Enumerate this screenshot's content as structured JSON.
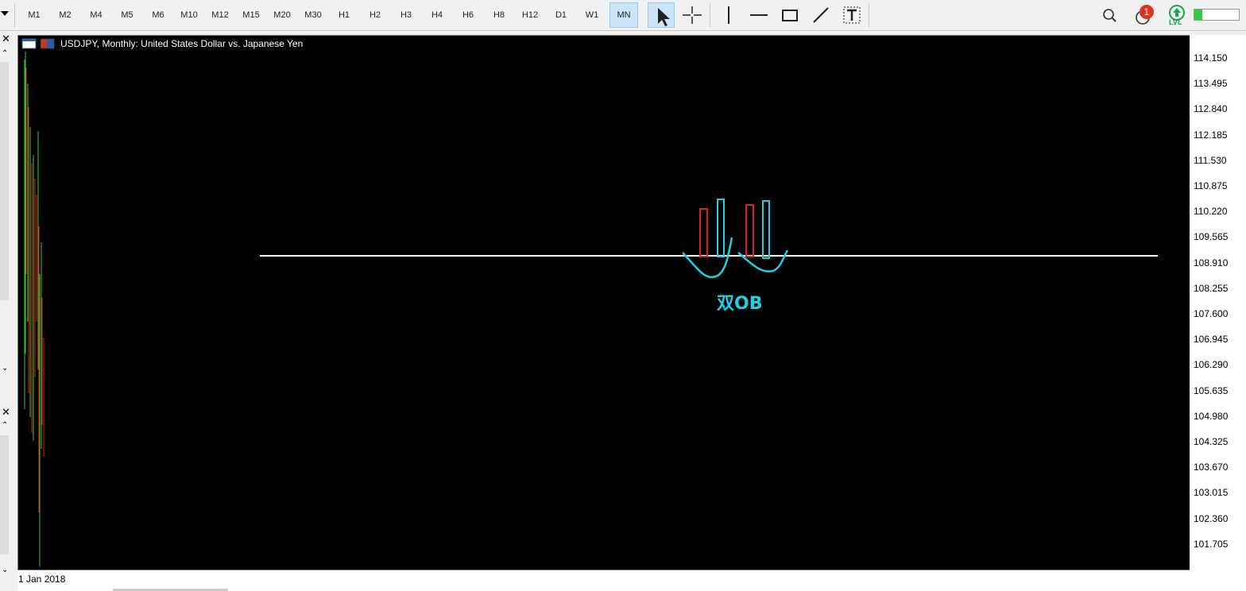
{
  "timeframes": [
    "M1",
    "M2",
    "M4",
    "M5",
    "M6",
    "M10",
    "M12",
    "M15",
    "M20",
    "M30",
    "H1",
    "H2",
    "H3",
    "H4",
    "H6",
    "H8",
    "H12",
    "D1",
    "W1",
    "MN"
  ],
  "active_timeframe": "MN",
  "notification_count": "1",
  "level_badge": "LVL",
  "chart": {
    "title": "USDJPY, Monthly:  United States Dollar vs. Japanese Yen",
    "annotation": "双OB",
    "date_label": "1 Jan 2018",
    "price_labels": [
      "114.150",
      "113.495",
      "112.840",
      "112.185",
      "111.530",
      "110.875",
      "110.220",
      "109.565",
      "108.910",
      "108.255",
      "107.600",
      "106.945",
      "106.290",
      "105.635",
      "104.980",
      "104.325",
      "103.670",
      "103.015",
      "102.360",
      "101.705"
    ]
  },
  "colors": {
    "bull": "#3cc83c",
    "bear": "#e02020",
    "drawing": "#19d3e6",
    "background": "#000000"
  }
}
